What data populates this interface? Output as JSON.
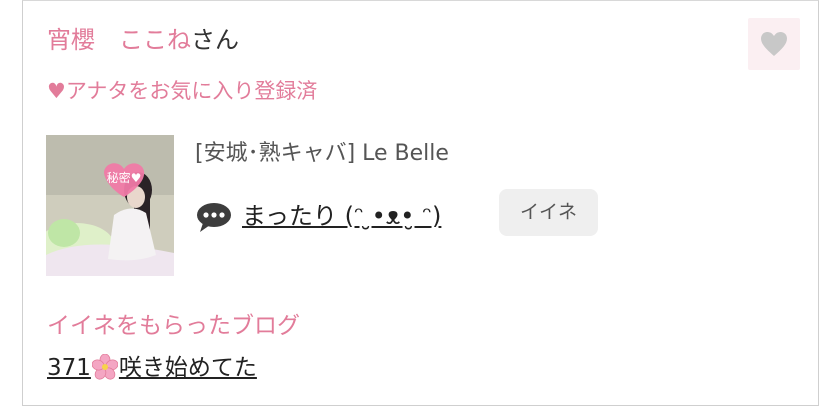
{
  "profile": {
    "name_part1": "宵櫻",
    "name_part2": "ここね",
    "honorific": "さん",
    "favorite_status": "♥アナタをお気に入り登録済",
    "favorite_icon": "heart-icon"
  },
  "shop": {
    "name": "[安城･熟キャバ]  Le Belle"
  },
  "post": {
    "thumbnail_badge": "秘密♥",
    "title": "まったり (ᵔ ̮•ᴥ•̮ ᵔ)",
    "like_button_label": "イイネ",
    "comment_icon": "speech-bubble-icon"
  },
  "liked_blog": {
    "heading": "イイネをもらったブログ",
    "count": "371",
    "title": "咲き始めてた",
    "emoji_icon": "cherry-blossom-icon"
  },
  "colors": {
    "accent_pink": "#e27c9a",
    "fav_button_bg": "#fbeff2",
    "heart_gray": "#c8c8c8",
    "like_button_bg": "#efefef"
  }
}
